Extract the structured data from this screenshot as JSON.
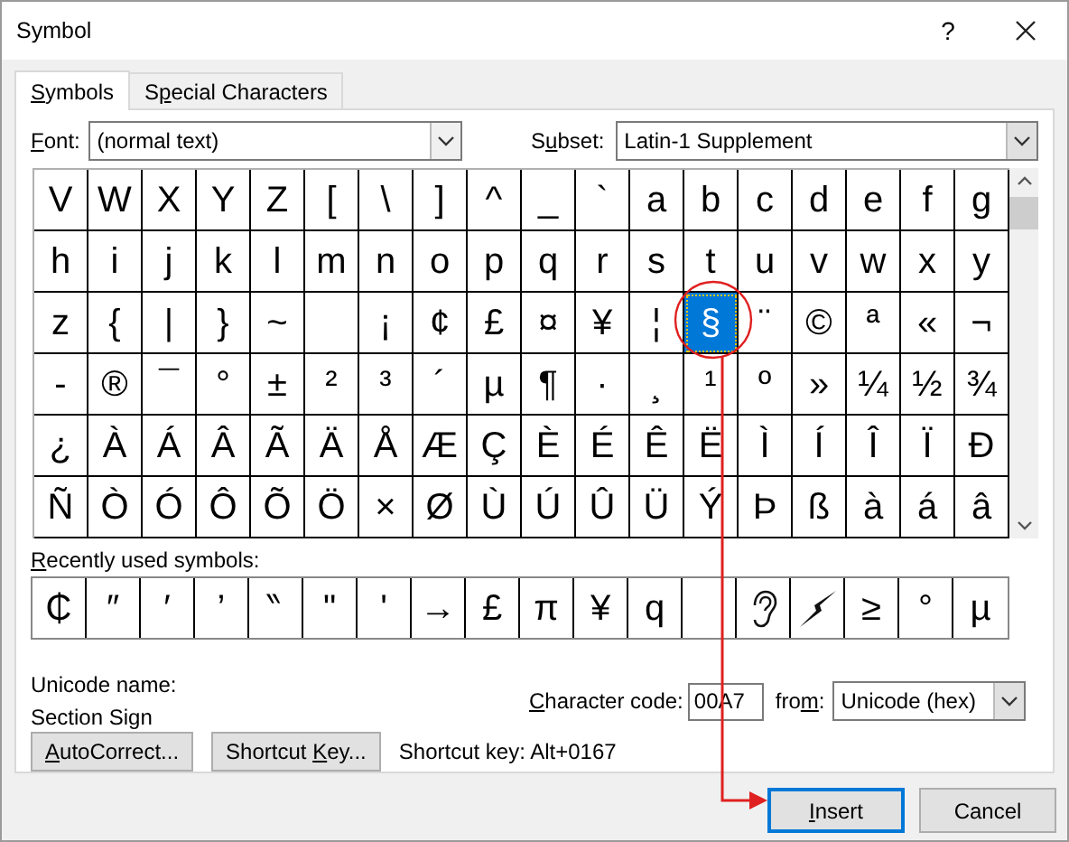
{
  "window": {
    "title": "Symbol",
    "help": "?"
  },
  "tabs": [
    {
      "access_key": "S",
      "label_end": "ymbols",
      "selected": true
    },
    {
      "label_start": "S",
      "access_key": "p",
      "label_end": "ecial Characters",
      "selected": false
    }
  ],
  "font": {
    "access_key": "F",
    "label_end": "ont:",
    "value": "(normal text)"
  },
  "subset": {
    "label_start": "S",
    "access_key": "u",
    "label_end": "bset:",
    "value": "Latin-1 Supplement"
  },
  "grid": [
    [
      {
        "char": "V",
        "selected": false
      },
      {
        "char": "W",
        "selected": false
      },
      {
        "char": "X",
        "selected": false
      },
      {
        "char": "Y",
        "selected": false
      },
      {
        "char": "Z",
        "selected": false
      },
      {
        "char": "[",
        "selected": false
      },
      {
        "char": "\\",
        "selected": false
      },
      {
        "char": "]",
        "selected": false
      },
      {
        "char": "^",
        "selected": false
      },
      {
        "char": "_",
        "selected": false
      },
      {
        "char": "`",
        "selected": false
      },
      {
        "char": "a",
        "selected": false
      },
      {
        "char": "b",
        "selected": false
      },
      {
        "char": "c",
        "selected": false
      },
      {
        "char": "d",
        "selected": false
      },
      {
        "char": "e",
        "selected": false
      },
      {
        "char": "f",
        "selected": false
      },
      {
        "char": "g",
        "selected": false
      }
    ],
    [
      {
        "char": "h",
        "selected": false
      },
      {
        "char": "i",
        "selected": false
      },
      {
        "char": "j",
        "selected": false
      },
      {
        "char": "k",
        "selected": false
      },
      {
        "char": "l",
        "selected": false
      },
      {
        "char": "m",
        "selected": false
      },
      {
        "char": "n",
        "selected": false
      },
      {
        "char": "o",
        "selected": false
      },
      {
        "char": "p",
        "selected": false
      },
      {
        "char": "q",
        "selected": false
      },
      {
        "char": "r",
        "selected": false
      },
      {
        "char": "s",
        "selected": false
      },
      {
        "char": "t",
        "selected": false
      },
      {
        "char": "u",
        "selected": false
      },
      {
        "char": "v",
        "selected": false
      },
      {
        "char": "w",
        "selected": false
      },
      {
        "char": "x",
        "selected": false
      },
      {
        "char": "y",
        "selected": false
      }
    ],
    [
      {
        "char": "z",
        "selected": false
      },
      {
        "char": "{",
        "selected": false
      },
      {
        "char": "|",
        "selected": false
      },
      {
        "char": "}",
        "selected": false
      },
      {
        "char": "~",
        "selected": false
      },
      {
        "selected": false
      },
      {
        "char": "¡",
        "selected": false
      },
      {
        "char": "¢",
        "selected": false
      },
      {
        "char": "£",
        "selected": false
      },
      {
        "char": "¤",
        "selected": false
      },
      {
        "char": "¥",
        "selected": false
      },
      {
        "char": "¦",
        "selected": false
      },
      {
        "char": "§",
        "selected": true
      },
      {
        "char": "¨",
        "selected": false
      },
      {
        "char": "©",
        "selected": false
      },
      {
        "char": "ª",
        "selected": false
      },
      {
        "char": "«",
        "selected": false
      },
      {
        "char": "¬",
        "selected": false
      }
    ],
    [
      {
        "char": "-",
        "selected": false
      },
      {
        "char": "®",
        "selected": false
      },
      {
        "char": "¯",
        "selected": false
      },
      {
        "char": "°",
        "selected": false
      },
      {
        "char": "±",
        "selected": false
      },
      {
        "char": "²",
        "selected": false
      },
      {
        "char": "³",
        "selected": false
      },
      {
        "char": "´",
        "selected": false
      },
      {
        "char": "µ",
        "selected": false
      },
      {
        "char": "¶",
        "selected": false
      },
      {
        "char": "·",
        "selected": false
      },
      {
        "char": "¸",
        "selected": false
      },
      {
        "char": "¹",
        "selected": false
      },
      {
        "char": "º",
        "selected": false
      },
      {
        "char": "»",
        "selected": false
      },
      {
        "char": "¼",
        "selected": false
      },
      {
        "char": "½",
        "selected": false
      },
      {
        "char": "¾",
        "selected": false
      }
    ],
    [
      {
        "char": "¿",
        "selected": false
      },
      {
        "char": "À",
        "selected": false
      },
      {
        "char": "Á",
        "selected": false
      },
      {
        "char": "Â",
        "selected": false
      },
      {
        "char": "Ã",
        "selected": false
      },
      {
        "char": "Ä",
        "selected": false
      },
      {
        "char": "Å",
        "selected": false
      },
      {
        "char": "Æ",
        "selected": false
      },
      {
        "char": "Ç",
        "selected": false
      },
      {
        "char": "È",
        "selected": false
      },
      {
        "char": "É",
        "selected": false
      },
      {
        "char": "Ê",
        "selected": false
      },
      {
        "char": "Ë",
        "selected": false
      },
      {
        "char": "Ì",
        "selected": false
      },
      {
        "char": "Í",
        "selected": false
      },
      {
        "char": "Î",
        "selected": false
      },
      {
        "char": "Ï",
        "selected": false
      },
      {
        "char": "Ð",
        "selected": false
      }
    ],
    [
      {
        "char": "Ñ",
        "selected": false
      },
      {
        "char": "Ò",
        "selected": false
      },
      {
        "char": "Ó",
        "selected": false
      },
      {
        "char": "Ô",
        "selected": false
      },
      {
        "char": "Õ",
        "selected": false
      },
      {
        "char": "Ö",
        "selected": false
      },
      {
        "char": "×",
        "selected": false
      },
      {
        "char": "Ø",
        "selected": false
      },
      {
        "char": "Ù",
        "selected": false
      },
      {
        "char": "Ú",
        "selected": false
      },
      {
        "char": "Û",
        "selected": false
      },
      {
        "char": "Ü",
        "selected": false
      },
      {
        "char": "Ý",
        "selected": false
      },
      {
        "char": "Þ",
        "selected": false
      },
      {
        "char": "ß",
        "selected": false
      },
      {
        "char": "à",
        "selected": false
      },
      {
        "char": "á",
        "selected": false
      },
      {
        "char": "â",
        "selected": false
      }
    ]
  ],
  "recent": {
    "access_key": "R",
    "label_end": "ecently used symbols:",
    "items": [
      {
        "kind": "char",
        "char": "₵"
      },
      {
        "kind": "char",
        "char": "″"
      },
      {
        "kind": "char",
        "char": "′"
      },
      {
        "kind": "char",
        "char": "’"
      },
      {
        "kind": "char",
        "char": "‶"
      },
      {
        "kind": "char",
        "char": "\""
      },
      {
        "kind": "char",
        "char": "'"
      },
      {
        "kind": "char",
        "char": "→"
      },
      {
        "kind": "char",
        "char": "£"
      },
      {
        "kind": "char",
        "char": "π"
      },
      {
        "kind": "char",
        "char": "¥"
      },
      {
        "kind": "char",
        "char": "q"
      },
      {
        "kind": "blank"
      },
      {
        "kind": "ear"
      },
      {
        "kind": "bolt"
      },
      {
        "kind": "char",
        "char": "≥"
      },
      {
        "kind": "char",
        "char": "°"
      },
      {
        "kind": "char",
        "char": "µ"
      }
    ]
  },
  "unicode_name": {
    "label": "Unicode name:",
    "value": "Section Sign"
  },
  "character_code": {
    "access_key": "C",
    "label_end": "haracter code:",
    "value": "00A7"
  },
  "from": {
    "label_start": "fro",
    "access_key": "m",
    "label_end": ":",
    "value": "Unicode (hex)"
  },
  "autocorrect_button": {
    "access_key": "A",
    "label_end": "utoCorrect..."
  },
  "shortcut_key_button": {
    "label_start": "Shortcut ",
    "access_key": "K",
    "label_end": "ey..."
  },
  "shortcut_key_text": "Shortcut key: Alt+0167",
  "buttons": [
    {
      "access_key": "I",
      "label_end": "nsert",
      "default": true
    },
    {
      "label_end": "Cancel",
      "default": false
    }
  ]
}
